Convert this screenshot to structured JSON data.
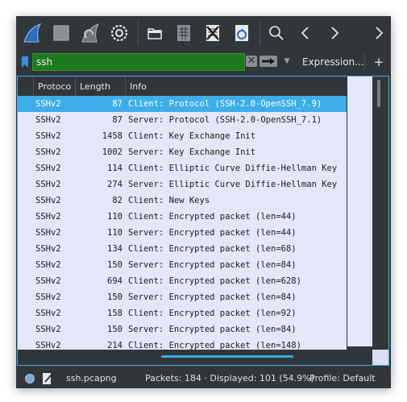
{
  "toolbar": {
    "buttons": [
      "shark-fin-icon",
      "stop-icon",
      "restart-icon",
      "options-gear-icon",
      "open-folder-icon",
      "file-set-icon",
      "close-file-icon",
      "reload-icon",
      "search-icon",
      "back-arrow-icon",
      "forward-arrow-icon",
      "more-arrow-icon"
    ]
  },
  "filter": {
    "value": "ssh",
    "clear_label": "✕",
    "expression_label": "Expression...",
    "add_label": "+"
  },
  "packet_list": {
    "columns": [
      "Protoco",
      "Length",
      "Info"
    ],
    "rows": [
      {
        "protocol": "SSHv2",
        "length": "87",
        "info": "Client: Protocol (SSH-2.0-OpenSSH_7.9)",
        "selected": true
      },
      {
        "protocol": "SSHv2",
        "length": "87",
        "info": "Server: Protocol (SSH-2.0-OpenSSH_7.1)"
      },
      {
        "protocol": "SSHv2",
        "length": "1458",
        "info": "Client: Key Exchange Init"
      },
      {
        "protocol": "SSHv2",
        "length": "1002",
        "info": "Server: Key Exchange Init"
      },
      {
        "protocol": "SSHv2",
        "length": "114",
        "info": "Client: Elliptic Curve Diffie-Hellman Key"
      },
      {
        "protocol": "SSHv2",
        "length": "274",
        "info": "Server: Elliptic Curve Diffie-Hellman Key"
      },
      {
        "protocol": "SSHv2",
        "length": "82",
        "info": "Client: New Keys"
      },
      {
        "protocol": "SSHv2",
        "length": "110",
        "info": "Client: Encrypted packet (len=44)"
      },
      {
        "protocol": "SSHv2",
        "length": "110",
        "info": "Server: Encrypted packet (len=44)"
      },
      {
        "protocol": "SSHv2",
        "length": "134",
        "info": "Client: Encrypted packet (len=68)"
      },
      {
        "protocol": "SSHv2",
        "length": "150",
        "info": "Server: Encrypted packet (len=84)"
      },
      {
        "protocol": "SSHv2",
        "length": "694",
        "info": "Client: Encrypted packet (len=628)"
      },
      {
        "protocol": "SSHv2",
        "length": "150",
        "info": "Server: Encrypted packet (len=84)"
      },
      {
        "protocol": "SSHv2",
        "length": "158",
        "info": "Client: Encrypted packet (len=92)"
      },
      {
        "protocol": "SSHv2",
        "length": "150",
        "info": "Server: Encrypted packet (len=84)"
      },
      {
        "protocol": "SSHv2",
        "length": "214",
        "info": "Client: Encrypted packet (len=148)"
      }
    ]
  },
  "status": {
    "file": "ssh.pcapng",
    "packets": "Packets: 184 · Displayed: 101 (54.9%)",
    "profile": "Profile: Default"
  },
  "colors": {
    "accent": "#3daee9",
    "filter_valid": "#1f7a1f",
    "row_bg": "#e6e6fa",
    "chrome": "#31363b"
  }
}
